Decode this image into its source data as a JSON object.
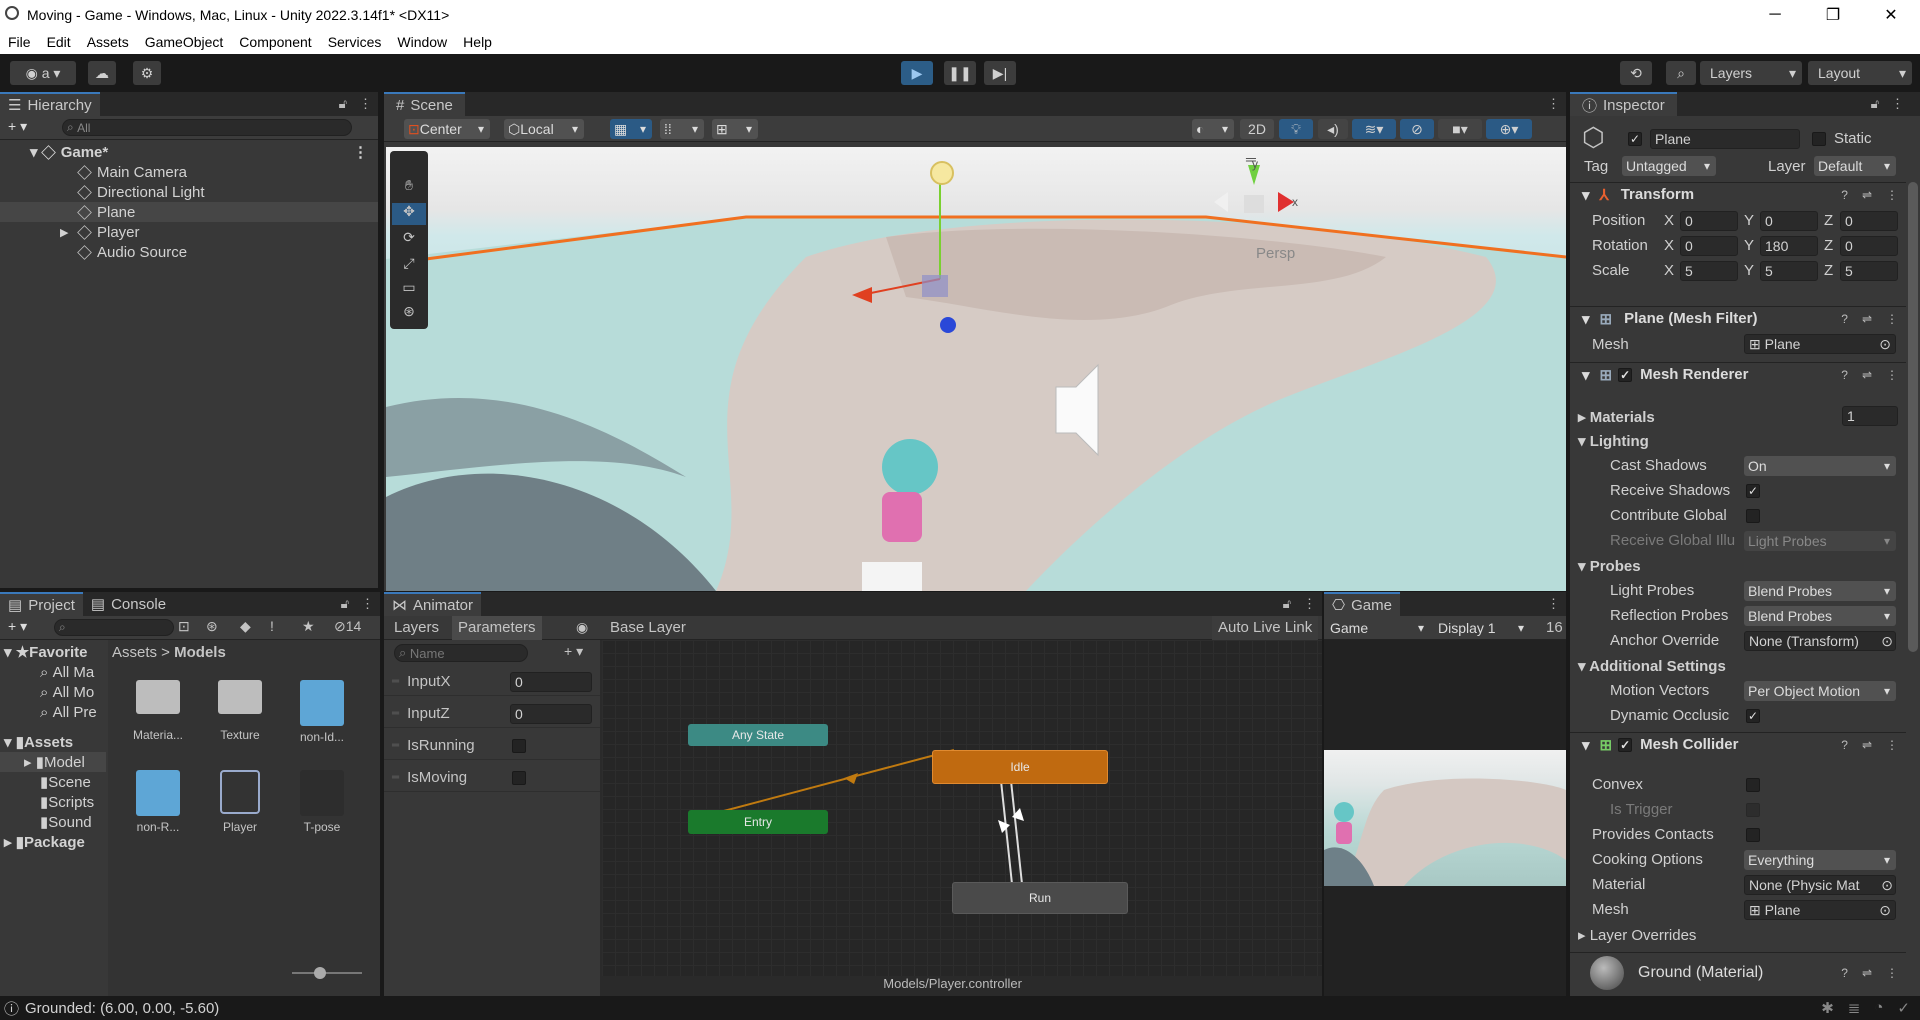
{
  "window": {
    "title": "Moving - Game - Windows, Mac, Linux - Unity 2022.3.14f1* <DX11>"
  },
  "menu": [
    "File",
    "Edit",
    "Assets",
    "GameObject",
    "Component",
    "Services",
    "Window",
    "Help"
  ],
  "toolbar": {
    "account": "a",
    "layers": "Layers",
    "layout": "Layout"
  },
  "hierarchy": {
    "tab": "Hierarchy",
    "search_placeholder": "All",
    "scene": "Game*",
    "items": [
      "Main Camera",
      "Directional Light",
      "Plane",
      "Player",
      "Audio Source"
    ]
  },
  "scene": {
    "tab": "Scene",
    "pivot": "Center",
    "space": "Local",
    "mode2d": "2D",
    "persp": "Persp",
    "gizmo_y": "y",
    "gizmo_x": "x"
  },
  "inspector": {
    "tab": "Inspector",
    "object_name": "Plane",
    "static": "Static",
    "tag_label": "Tag",
    "tag": "Untagged",
    "layer_label": "Layer",
    "layer": "Default",
    "transform": {
      "title": "Transform",
      "position": [
        "0",
        "0",
        "0"
      ],
      "rotation": [
        "0",
        "180",
        "0"
      ],
      "scale": [
        "5",
        "5",
        "5"
      ],
      "labels": [
        "Position",
        "Rotation",
        "Scale"
      ],
      "axes": [
        "X",
        "Y",
        "Z"
      ]
    },
    "mesh_filter": {
      "title": "Plane (Mesh Filter)",
      "mesh_label": "Mesh",
      "mesh": "Plane"
    },
    "mesh_renderer": {
      "title": "Mesh Renderer",
      "materials": "Materials",
      "materials_count": "1",
      "lighting": "Lighting",
      "cast_shadows": "Cast Shadows",
      "cast_shadows_val": "On",
      "receive_shadows": "Receive Shadows",
      "contribute_global": "Contribute Global",
      "receive_global": "Receive Global Illu",
      "receive_global_val": "Light Probes",
      "probes": "Probes",
      "light_probes": "Light Probes",
      "light_probes_val": "Blend Probes",
      "reflection_probes": "Reflection Probes",
      "reflection_probes_val": "Blend Probes",
      "anchor_override": "Anchor Override",
      "anchor_override_val": "None (Transform)",
      "additional": "Additional Settings",
      "motion_vectors": "Motion Vectors",
      "motion_vectors_val": "Per Object Motion",
      "dynamic_occlusion": "Dynamic Occlusic"
    },
    "mesh_collider": {
      "title": "Mesh Collider",
      "convex": "Convex",
      "is_trigger": "Is Trigger",
      "provides_contacts": "Provides Contacts",
      "cooking_options": "Cooking Options",
      "cooking_options_val": "Everything",
      "material": "Material",
      "material_val": "None (Physic Mat",
      "mesh": "Mesh",
      "mesh_val": "Plane",
      "layer_overrides": "Layer Overrides"
    },
    "material": {
      "title": "Ground (Material)"
    }
  },
  "project": {
    "tab_project": "Project",
    "tab_console": "Console",
    "hidden_count": "14",
    "breadcrumb": [
      "Assets",
      "Models"
    ],
    "favorites": "Favorite",
    "fav_items": [
      "All Ma",
      "All Mo",
      "All Pre"
    ],
    "assets": "Assets",
    "asset_folders": [
      "Model",
      "Scene",
      "Scripts",
      "Sound"
    ],
    "packages": "Package",
    "files": [
      "Materia...",
      "Texture",
      "non-Id...",
      "non-R...",
      "Player",
      "T-pose"
    ]
  },
  "animator": {
    "tab": "Animator",
    "layers_tab": "Layers",
    "params_tab": "Parameters",
    "base_layer": "Base Layer",
    "auto_live": "Auto Live Link",
    "search_placeholder": "Name",
    "params": [
      {
        "name": "InputX",
        "value": "0"
      },
      {
        "name": "InputZ",
        "value": "0"
      },
      {
        "name": "IsRunning",
        "value": ""
      },
      {
        "name": "IsMoving",
        "value": ""
      }
    ],
    "states": {
      "any": "Any State",
      "entry": "Entry",
      "idle": "Idle",
      "run": "Run"
    },
    "path": "Models/Player.controller"
  },
  "game": {
    "tab": "Game",
    "view": "Game",
    "display": "Display 1",
    "res": "16"
  },
  "status": {
    "text": "Grounded: (6.00, 0.00, -5.60)"
  },
  "colors": {
    "accent": "#3a79bb",
    "idle": "#c06a10",
    "entry": "#1a7a2c",
    "any": "#3c8a84"
  }
}
